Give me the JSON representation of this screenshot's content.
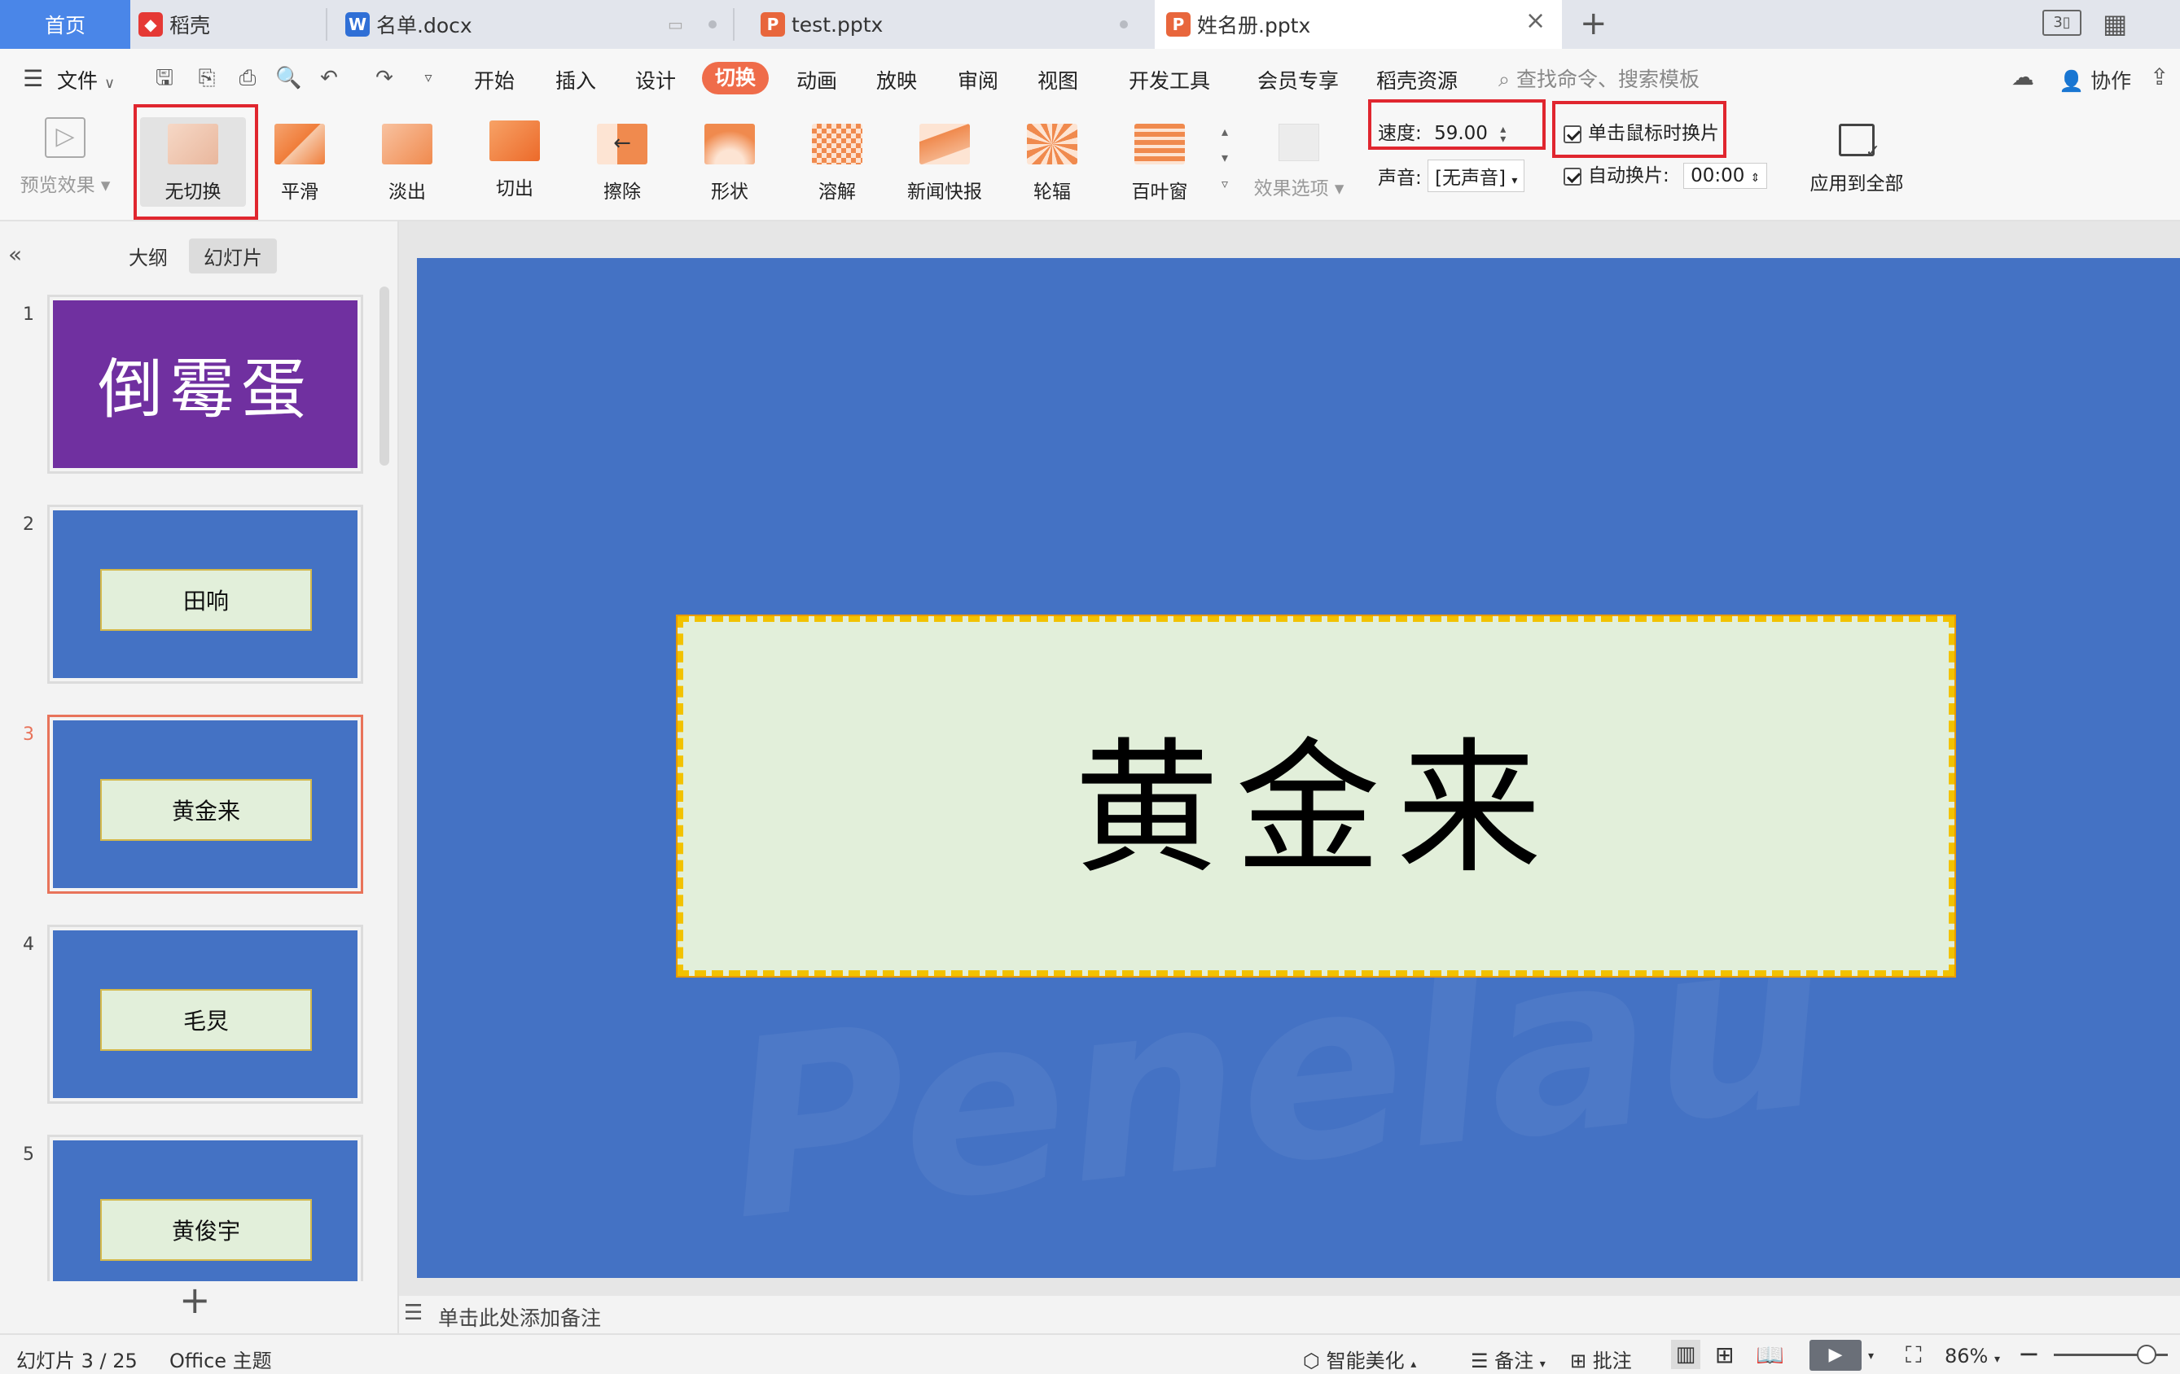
{
  "tabs": {
    "home": "首页",
    "docer": "稻壳",
    "doc1": "名单.docx",
    "doc2": "test.pptx",
    "doc3": "姓名册.pptx"
  },
  "menu": {
    "file": "文件",
    "items": [
      "开始",
      "插入",
      "设计",
      "切换",
      "动画",
      "放映",
      "审阅",
      "视图",
      "开发工具",
      "会员专享",
      "稻壳资源"
    ],
    "active_index": 3,
    "search": "查找命令、搜索模板",
    "collab": "协作"
  },
  "ribbon": {
    "preview": "预览效果",
    "transitions": [
      "无切换",
      "平滑",
      "淡出",
      "切出",
      "擦除",
      "形状",
      "溶解",
      "新闻快报",
      "轮辐",
      "百叶窗"
    ],
    "effect_options": "效果选项",
    "speed_label": "速度:",
    "speed_value": "59.00",
    "sound_label": "声音:",
    "sound_value": "[无声音]",
    "on_click_label": "单击鼠标时换片",
    "auto_label": "自动换片:",
    "auto_value": "00:00",
    "apply_all": "应用到全部"
  },
  "left_panel": {
    "outline_tab": "大纲",
    "slides_tab": "幻灯片",
    "slides": [
      {
        "num": "1",
        "text": "倒霉蛋"
      },
      {
        "num": "2",
        "text": "田响"
      },
      {
        "num": "3",
        "text": "黄金来"
      },
      {
        "num": "4",
        "text": "毛炅"
      },
      {
        "num": "5",
        "text": "黄俊宇"
      }
    ],
    "add": "+"
  },
  "slide": {
    "main_text": "黄金来",
    "watermark": "Penelau"
  },
  "notes_placeholder": "单击此处添加备注",
  "status": {
    "slide_info": "幻灯片 3 / 25",
    "theme": "Office 主题",
    "beautify": "智能美化",
    "notes": "备注",
    "comments": "批注",
    "zoom": "86%"
  },
  "colors": {
    "accent": "#ef6c4a",
    "slide_bg": "#4472c4",
    "box_fill": "#e2efda",
    "title_slide_bg": "#7030a0",
    "highlight": "#e0262f"
  }
}
